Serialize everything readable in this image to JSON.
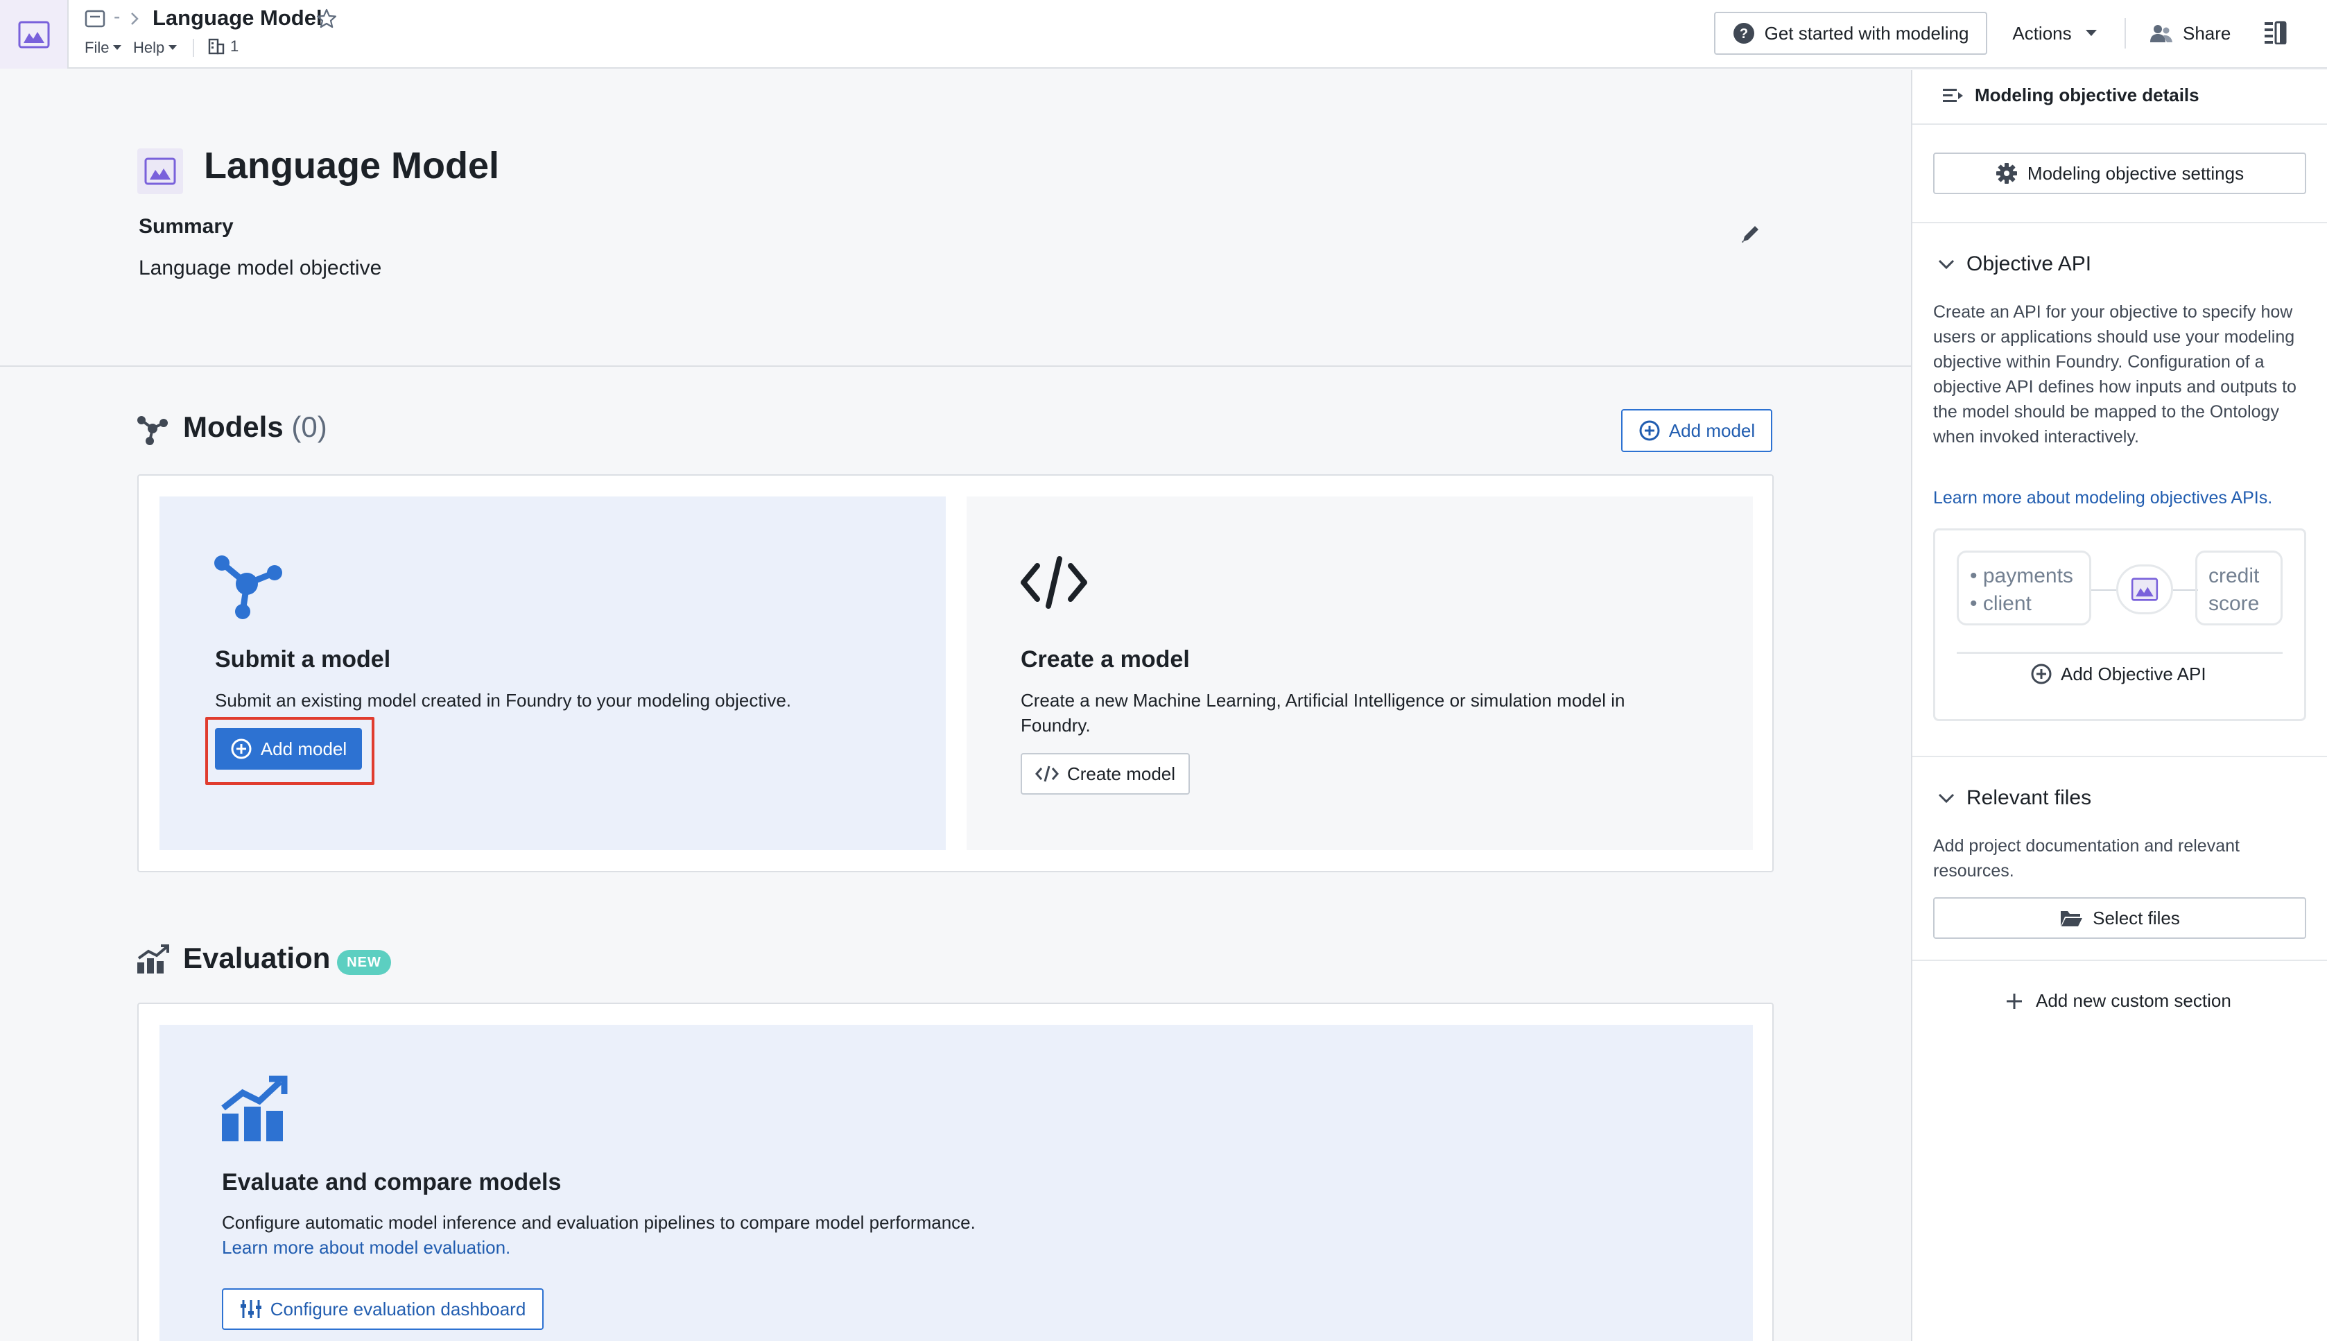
{
  "topbar": {
    "crumb_sep": "-",
    "title": "Language Model",
    "menu_file": "File",
    "menu_help": "Help",
    "count": "1",
    "get_started": "Get started with modeling",
    "actions": "Actions",
    "share": "Share"
  },
  "header": {
    "title": "Language Model",
    "summary_label": "Summary",
    "summary_text": "Language model objective"
  },
  "models": {
    "title": "Models",
    "count": "(0)",
    "add_model": "Add model",
    "submit": {
      "title": "Submit a model",
      "description": "Submit an existing model created in Foundry to your modeling objective.",
      "button": "Add model"
    },
    "create": {
      "title": "Create a model",
      "description": "Create a new Machine Learning, Artificial Intelligence or simulation model in Foundry.",
      "button": "Create model"
    }
  },
  "evaluation": {
    "title": "Evaluation",
    "badge": "NEW",
    "card_title": "Evaluate and compare models",
    "description": "Configure automatic model inference and evaluation pipelines to compare model performance.",
    "link": "Learn more about model evaluation.",
    "button": "Configure evaluation dashboard"
  },
  "right_panel": {
    "header": "Modeling objective details",
    "settings_button": "Modeling objective settings",
    "api": {
      "title": "Objective API",
      "description": "Create an API for your objective to specify how users or applications should use your modeling objective within Foundry. Configuration of a objective API defines how inputs and outputs to the model should be mapped to the Ontology when invoked interactively.",
      "link": "Learn more about modeling objectives APIs.",
      "diagram_input_1": "• payments",
      "diagram_input_2": "• client",
      "diagram_output_1": "credit",
      "diagram_output_2": "score",
      "add_button": "Add Objective API"
    },
    "files": {
      "title": "Relevant files",
      "description": "Add project documentation and relevant resources.",
      "button": "Select files"
    },
    "add_section": "Add new custom section"
  },
  "colors": {
    "primary": "#2d72d2",
    "link": "#215db0",
    "highlight": "#e03c2e",
    "badge": "#5ccfc1",
    "app_icon": "#7961db"
  },
  "icons": [
    "app-icon",
    "document-icon",
    "chevron-right-icon",
    "star-icon",
    "caret-down-icon",
    "building-icon",
    "help-icon",
    "people-icon",
    "panel-icon",
    "edit-icon",
    "graph-icon",
    "add-circle-icon",
    "code-icon",
    "chart-icon",
    "sliders-icon",
    "list-detail-icon",
    "gear-icon",
    "chevron-down-icon",
    "folder-icon",
    "plus-icon"
  ]
}
